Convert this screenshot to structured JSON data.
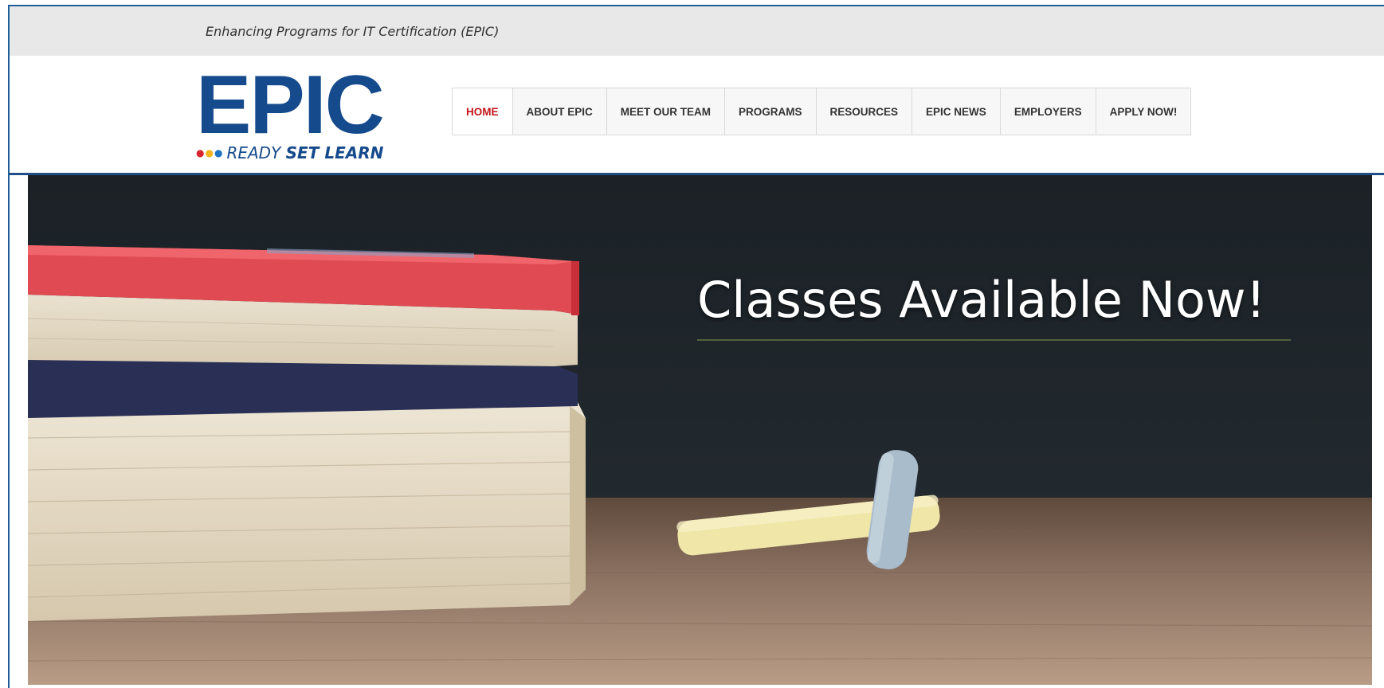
{
  "topbar": {
    "tagline": "Enhancing Programs for IT Certification (EPIC)"
  },
  "logo": {
    "word": "EPIC",
    "tag_plain": "READY ",
    "tag_strong": "SET LEARN"
  },
  "nav": {
    "items": [
      {
        "label": "HOME",
        "active": true
      },
      {
        "label": "ABOUT EPIC"
      },
      {
        "label": "MEET OUR TEAM"
      },
      {
        "label": "PROGRAMS"
      },
      {
        "label": "RESOURCES"
      },
      {
        "label": "EPIC NEWS"
      },
      {
        "label": "EMPLOYERS"
      },
      {
        "label": "APPLY NOW!"
      }
    ]
  },
  "hero": {
    "title": "Classes Available Now!"
  },
  "colors": {
    "brand_blue": "#154a8c",
    "active_red": "#c4161c",
    "topbar_gray": "#e8e8e8"
  }
}
